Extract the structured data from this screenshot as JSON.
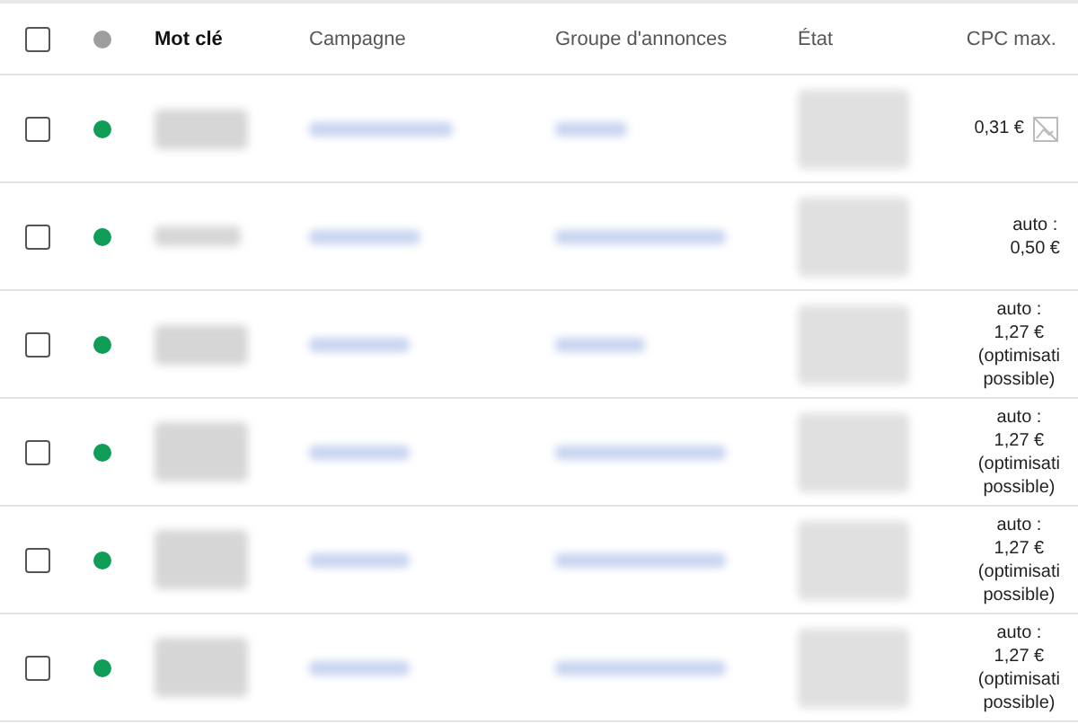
{
  "table": {
    "header": {
      "checked": false,
      "color": "#9e9e9e",
      "columns": [
        "Mot clé",
        "Campagne",
        "Groupe d'annonces",
        "État",
        "CPC max."
      ]
    },
    "rows": [
      {
        "checked": false,
        "color": "#0f9d58",
        "cpc_lines": [
          "0,31 €"
        ],
        "image_icon": true
      },
      {
        "checked": false,
        "color": "#0f9d58",
        "cpc_lines": [
          "auto :",
          "0,50 €"
        ],
        "image_icon": false
      },
      {
        "checked": false,
        "color": "#0f9d58",
        "cpc_lines": [
          "auto :",
          "1,27 €",
          "(optimisati",
          "possible)"
        ],
        "image_icon": false
      },
      {
        "checked": false,
        "color": "#0f9d58",
        "cpc_lines": [
          "auto :",
          "1,27 €",
          "(optimisati",
          "possible)"
        ],
        "image_icon": false
      },
      {
        "checked": false,
        "color": "#0f9d58",
        "cpc_lines": [
          "auto :",
          "1,27 €",
          "(optimisati",
          "possible)"
        ],
        "image_icon": false
      },
      {
        "checked": false,
        "color": "#0f9d58",
        "cpc_lines": [
          "auto :",
          "1,27 €",
          "(optimisati",
          "possible)"
        ],
        "image_icon": false
      }
    ]
  }
}
